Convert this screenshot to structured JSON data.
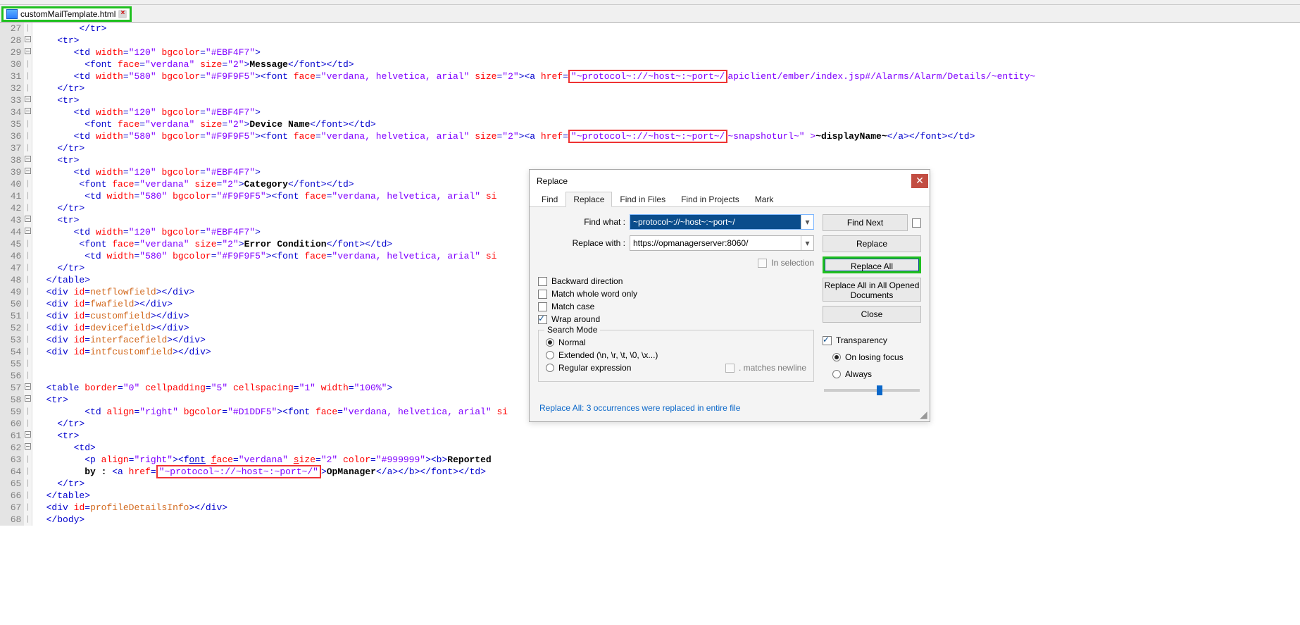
{
  "tab": {
    "filename": "customMailTemplate.html"
  },
  "line_start": 27,
  "highlighted_urls": {
    "a": "\"~protocol~://~host~:~port~/",
    "b": "\"~protocol~://~host~:~port~/",
    "c": "\"~protocol~://~host~:~port~/\""
  },
  "code_text": {
    "l31_tail": "apiclient/ember/index.jsp#/Alarms/Alarm/Details/~entity~",
    "l36_tail1": "~snapshoturl~\" >",
    "l36_tail2": "~displayName~",
    "l36_tail3": "</a></font></td>",
    "l41_tail": "si",
    "l46_tail": "si",
    "l59_tail": "si",
    "message": "Message",
    "devname": "Device Name",
    "category": "Category",
    "errcond": "Error Condition",
    "reported": "Reported",
    "by": "by : ",
    "opm": "OpManager",
    "ids": {
      "netflow": "netflowfield",
      "fwa": "fwafield",
      "custom": "customfield",
      "device": "devicefield",
      "iface": "interfacefield",
      "intfc": "intfcustomfield",
      "profile": "profileDetailsInfo"
    }
  },
  "dialog": {
    "title": "Replace",
    "tabs": [
      "Find",
      "Replace",
      "Find in Files",
      "Find in Projects",
      "Mark"
    ],
    "active_tab": 1,
    "find_label": "Find what :",
    "find_value": "~protocol~://~host~:~port~/",
    "replace_label": "Replace with :",
    "replace_value": "https://opmanagerserver:8060/",
    "in_selection": "In selection",
    "checks": {
      "backward": "Backward direction",
      "wholeword": "Match whole word only",
      "matchcase": "Match case",
      "wrap": "Wrap around"
    },
    "search_mode_legend": "Search Mode",
    "modes": {
      "normal": "Normal",
      "extended": "Extended (\\n, \\r, \\t, \\0, \\x...)",
      "regex": "Regular expression",
      "dotnl": ". matches newline"
    },
    "trans_legend": "Transparency",
    "trans_opts": {
      "losing": "On losing focus",
      "always": "Always"
    },
    "buttons": {
      "findnext": "Find Next",
      "replace": "Replace",
      "replaceall": "Replace All",
      "replaceallopen": "Replace All in All Opened Documents",
      "close": "Close"
    },
    "status": "Replace All: 3 occurrences were replaced in entire file"
  }
}
